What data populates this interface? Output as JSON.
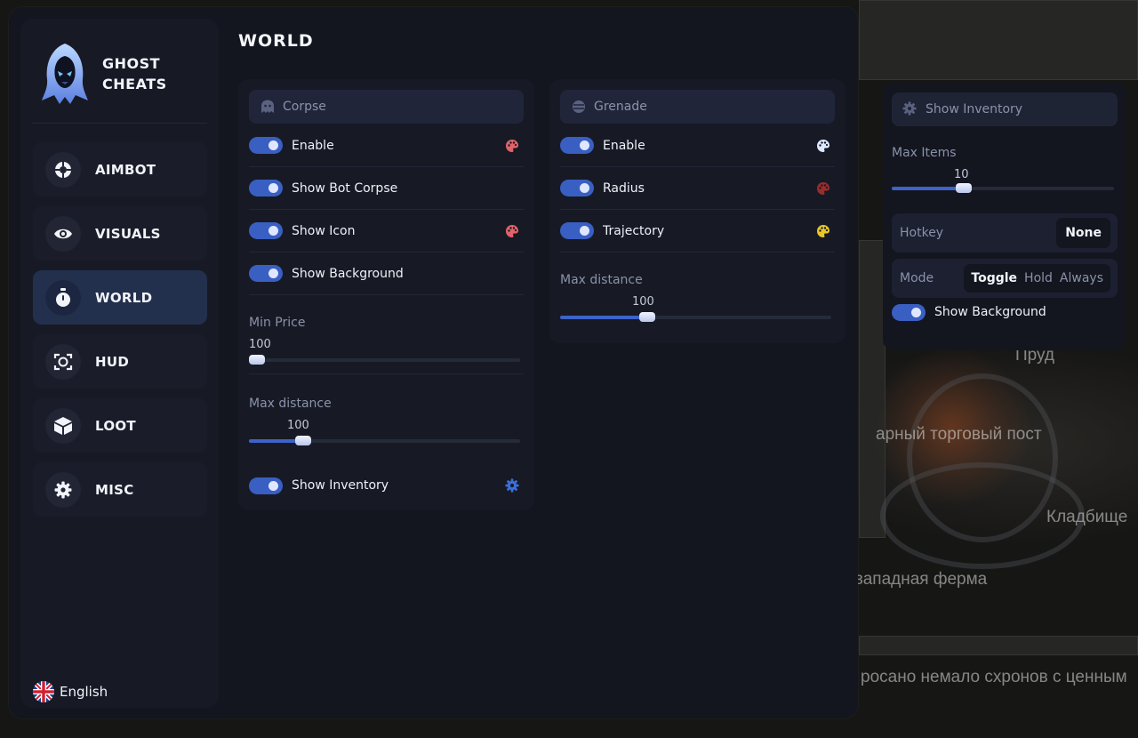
{
  "brand": {
    "line1": "GHOST",
    "line2": "CHEATS"
  },
  "page_title": "WORLD",
  "nav": [
    {
      "label": "AIMBOT",
      "icon": "crosshair-icon",
      "active": false
    },
    {
      "label": "VISUALS",
      "icon": "eye-icon",
      "active": false
    },
    {
      "label": "WORLD",
      "icon": "stopwatch-icon",
      "active": true
    },
    {
      "label": "HUD",
      "icon": "hud-frame-icon",
      "active": false
    },
    {
      "label": "LOOT",
      "icon": "box-icon",
      "active": false
    },
    {
      "label": "MISC",
      "icon": "gear-icon",
      "active": false
    }
  ],
  "language": {
    "label": "English",
    "icon": "uk-flag-icon"
  },
  "corpse": {
    "title": "Corpse",
    "enable": {
      "label": "Enable",
      "on": true,
      "color": "#e0636a"
    },
    "show_bot_corpse": {
      "label": "Show Bot Corpse",
      "on": true
    },
    "show_icon": {
      "label": "Show Icon",
      "on": true,
      "color": "#e0636a"
    },
    "show_background": {
      "label": "Show Background",
      "on": true
    },
    "min_price": {
      "label": "Min Price",
      "value": "100",
      "fraction": 0.0
    },
    "max_distance": {
      "label": "Max distance",
      "value": "100",
      "fraction": 0.18
    },
    "show_inventory": {
      "label": "Show Inventory",
      "on": true
    }
  },
  "grenade": {
    "title": "Grenade",
    "enable": {
      "label": "Enable",
      "on": true,
      "color": "#dde7ff"
    },
    "radius": {
      "label": "Radius",
      "on": true,
      "color": "#9b2c2c"
    },
    "trajectory": {
      "label": "Trajectory",
      "on": true,
      "color": "#e8c62a"
    },
    "max_distance": {
      "label": "Max distance",
      "value": "100",
      "fraction": 0.31
    }
  },
  "inventory_popup": {
    "title": "Show Inventory",
    "max_items": {
      "label": "Max Items",
      "value": "10",
      "fraction": 0.31
    },
    "hotkey": {
      "label": "Hotkey",
      "value": "None"
    },
    "mode": {
      "label": "Mode",
      "options": [
        "Toggle",
        "Hold",
        "Always"
      ],
      "selected": "Toggle"
    },
    "show_background": {
      "label": "Show Background",
      "on": true
    }
  },
  "map_labels": {
    "pond": "Пруд",
    "post": "арный торговый пост",
    "cemetery": "Кладбище",
    "farm": "западная ферма",
    "caption": "росано немало схронов с ценным"
  }
}
